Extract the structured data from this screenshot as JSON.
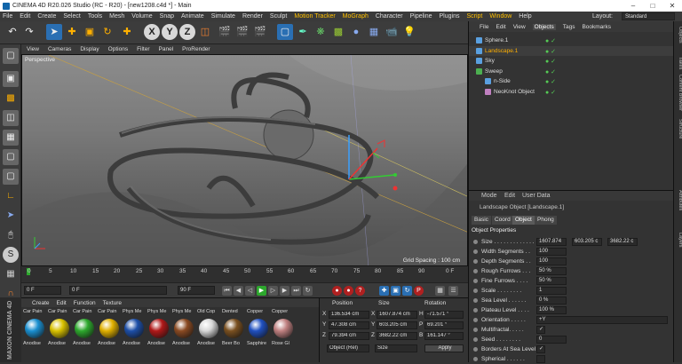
{
  "window": {
    "title": "CINEMA 4D R20.026 Studio (RC - R20) - [new1208.c4d *] - Main"
  },
  "menu": [
    "File",
    "Edit",
    "Create",
    "Select",
    "Tools",
    "Mesh",
    "Volume",
    "Snap",
    "Animate",
    "Simulate",
    "Render",
    "Sculpt",
    "Motion Tracker",
    "MoGraph",
    "Character",
    "Pipeline",
    "Plugins",
    "Script",
    "Window",
    "Help"
  ],
  "layout": {
    "label": "Layout:",
    "value": "Standard"
  },
  "viewport": {
    "menu": [
      "View",
      "Cameras",
      "Display",
      "Options",
      "Filter",
      "Panel",
      "ProRender"
    ],
    "camera_label": "Perspective",
    "grid_spacing": "Grid Spacing : 100 cm"
  },
  "timeline": {
    "ticks": [
      "0",
      "5",
      "10",
      "15",
      "20",
      "25",
      "30",
      "35",
      "40",
      "45",
      "50",
      "55",
      "60",
      "65",
      "70",
      "75",
      "80",
      "85",
      "90"
    ],
    "frame_label": "0 F"
  },
  "transport": {
    "start": "0 F",
    "current": "0 F",
    "end": "90 F",
    "end2": "90 F"
  },
  "materials": {
    "menu": [
      "Create",
      "Edit",
      "Function",
      "Texture"
    ],
    "items": [
      {
        "name": "Car Pain",
        "sub": "Anodise",
        "color": "#1a8fd0"
      },
      {
        "name": "Car Pain",
        "sub": "Anodise",
        "color": "#d9c200"
      },
      {
        "name": "Car Pain",
        "sub": "Anodise",
        "color": "#2da82d"
      },
      {
        "name": "Car Pain",
        "sub": "Anodise",
        "color": "#e0b000"
      },
      {
        "name": "Phys Me",
        "sub": "Anodise",
        "color": "#1d4fa8"
      },
      {
        "name": "Phys Me",
        "sub": "Anodise",
        "color": "#b01818"
      },
      {
        "name": "Phys Me",
        "sub": "Anodise",
        "color": "#8a4a22"
      },
      {
        "name": "Old Cop",
        "sub": "Anodise",
        "color": "#d8d8d8"
      },
      {
        "name": "Dented",
        "sub": "Beer Bo",
        "color": "#7a5020"
      },
      {
        "name": "Copper",
        "sub": "Sapphire",
        "color": "#2050c0"
      },
      {
        "name": "Copper",
        "sub": "Rose Gl",
        "color": "#c08080"
      }
    ]
  },
  "coords": {
    "headers": [
      "Position",
      "Size",
      "Rotation"
    ],
    "rows": [
      {
        "axis": "X",
        "pos": "136.534 cm",
        "saxis": "X",
        "size": "1607.874 cm",
        "raxis": "H",
        "rot": "-71.571 °"
      },
      {
        "axis": "Y",
        "pos": "47.308 cm",
        "saxis": "Y",
        "size": "603.205 cm",
        "raxis": "P",
        "rot": "69.201 °"
      },
      {
        "axis": "Z",
        "pos": "79.394 cm",
        "saxis": "Z",
        "size": "3682.22 cm",
        "raxis": "B",
        "rot": "161.147 °"
      }
    ],
    "mode": "Object (Rel)",
    "size_mode": "Size",
    "apply": "Apply"
  },
  "objects": {
    "tabs": [
      "File",
      "Edit",
      "View",
      "Objects",
      "Tags",
      "Bookmarks"
    ],
    "items": [
      {
        "name": "Sphere.1",
        "color": "#5aa0e0",
        "indent": 0
      },
      {
        "name": "Landscape.1",
        "color": "#5aa0e0",
        "indent": 0,
        "selected": true
      },
      {
        "name": "Sky",
        "color": "#5aa0e0",
        "indent": 0
      },
      {
        "name": "Sweep",
        "color": "#4caf50",
        "indent": 0
      },
      {
        "name": "n-Side",
        "color": "#5aa0e0",
        "indent": 1
      },
      {
        "name": "NeoKnot Object",
        "color": "#c080c0",
        "indent": 1
      }
    ]
  },
  "attributes": {
    "menu": [
      "Mode",
      "Edit",
      "User Data"
    ],
    "title": "Landscape Object [Landscape.1]",
    "tabs": [
      "Basic",
      "Coord",
      "Object",
      "Phong"
    ],
    "section": "Object Properties",
    "props": [
      {
        "label": "Size . . . . . . . . . . . . .",
        "v1": "1607.874",
        "v2": "603.205 c",
        "v3": "3682.22 c"
      },
      {
        "label": "Width Segments . .",
        "v1": "100"
      },
      {
        "label": "Depth Segments . .",
        "v1": "100"
      },
      {
        "label": "Rough Furrows . . .",
        "v1": "50 %"
      },
      {
        "label": "Fine Furrows . . . .",
        "v1": "50 %"
      },
      {
        "label": "Scale . . . . . . . .",
        "v1": "1"
      },
      {
        "label": "Sea Level . . . . . .",
        "v1": "0 %"
      },
      {
        "label": "Plateau Level . . . .",
        "v1": "100 %"
      },
      {
        "label": "Orientation . . . . .",
        "v1": "+Y"
      },
      {
        "label": "Multifractal. . . . .",
        "v1": "✓"
      },
      {
        "label": "Seed . . . . . . . .",
        "v1": "0"
      },
      {
        "label": "Borders At Sea Level",
        "v1": "✓"
      },
      {
        "label": "Spherical . . . . . .",
        "v1": ""
      }
    ]
  },
  "side_tabs": [
    "Objects",
    "Takes",
    "Content Browser",
    "Structure",
    "Attributes",
    "Layers"
  ],
  "brand": "MAXON CINEMA 4D"
}
